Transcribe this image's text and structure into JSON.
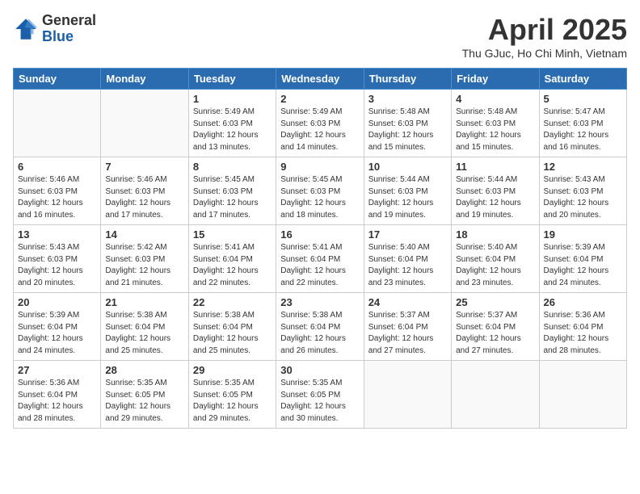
{
  "header": {
    "logo_general": "General",
    "logo_blue": "Blue",
    "month_year": "April 2025",
    "location": "Thu GJuc, Ho Chi Minh, Vietnam"
  },
  "weekdays": [
    "Sunday",
    "Monday",
    "Tuesday",
    "Wednesday",
    "Thursday",
    "Friday",
    "Saturday"
  ],
  "weeks": [
    [
      {
        "day": "",
        "info": ""
      },
      {
        "day": "",
        "info": ""
      },
      {
        "day": "1",
        "info": "Sunrise: 5:49 AM\nSunset: 6:03 PM\nDaylight: 12 hours\nand 13 minutes."
      },
      {
        "day": "2",
        "info": "Sunrise: 5:49 AM\nSunset: 6:03 PM\nDaylight: 12 hours\nand 14 minutes."
      },
      {
        "day": "3",
        "info": "Sunrise: 5:48 AM\nSunset: 6:03 PM\nDaylight: 12 hours\nand 15 minutes."
      },
      {
        "day": "4",
        "info": "Sunrise: 5:48 AM\nSunset: 6:03 PM\nDaylight: 12 hours\nand 15 minutes."
      },
      {
        "day": "5",
        "info": "Sunrise: 5:47 AM\nSunset: 6:03 PM\nDaylight: 12 hours\nand 16 minutes."
      }
    ],
    [
      {
        "day": "6",
        "info": "Sunrise: 5:46 AM\nSunset: 6:03 PM\nDaylight: 12 hours\nand 16 minutes."
      },
      {
        "day": "7",
        "info": "Sunrise: 5:46 AM\nSunset: 6:03 PM\nDaylight: 12 hours\nand 17 minutes."
      },
      {
        "day": "8",
        "info": "Sunrise: 5:45 AM\nSunset: 6:03 PM\nDaylight: 12 hours\nand 17 minutes."
      },
      {
        "day": "9",
        "info": "Sunrise: 5:45 AM\nSunset: 6:03 PM\nDaylight: 12 hours\nand 18 minutes."
      },
      {
        "day": "10",
        "info": "Sunrise: 5:44 AM\nSunset: 6:03 PM\nDaylight: 12 hours\nand 19 minutes."
      },
      {
        "day": "11",
        "info": "Sunrise: 5:44 AM\nSunset: 6:03 PM\nDaylight: 12 hours\nand 19 minutes."
      },
      {
        "day": "12",
        "info": "Sunrise: 5:43 AM\nSunset: 6:03 PM\nDaylight: 12 hours\nand 20 minutes."
      }
    ],
    [
      {
        "day": "13",
        "info": "Sunrise: 5:43 AM\nSunset: 6:03 PM\nDaylight: 12 hours\nand 20 minutes."
      },
      {
        "day": "14",
        "info": "Sunrise: 5:42 AM\nSunset: 6:03 PM\nDaylight: 12 hours\nand 21 minutes."
      },
      {
        "day": "15",
        "info": "Sunrise: 5:41 AM\nSunset: 6:04 PM\nDaylight: 12 hours\nand 22 minutes."
      },
      {
        "day": "16",
        "info": "Sunrise: 5:41 AM\nSunset: 6:04 PM\nDaylight: 12 hours\nand 22 minutes."
      },
      {
        "day": "17",
        "info": "Sunrise: 5:40 AM\nSunset: 6:04 PM\nDaylight: 12 hours\nand 23 minutes."
      },
      {
        "day": "18",
        "info": "Sunrise: 5:40 AM\nSunset: 6:04 PM\nDaylight: 12 hours\nand 23 minutes."
      },
      {
        "day": "19",
        "info": "Sunrise: 5:39 AM\nSunset: 6:04 PM\nDaylight: 12 hours\nand 24 minutes."
      }
    ],
    [
      {
        "day": "20",
        "info": "Sunrise: 5:39 AM\nSunset: 6:04 PM\nDaylight: 12 hours\nand 24 minutes."
      },
      {
        "day": "21",
        "info": "Sunrise: 5:38 AM\nSunset: 6:04 PM\nDaylight: 12 hours\nand 25 minutes."
      },
      {
        "day": "22",
        "info": "Sunrise: 5:38 AM\nSunset: 6:04 PM\nDaylight: 12 hours\nand 25 minutes."
      },
      {
        "day": "23",
        "info": "Sunrise: 5:38 AM\nSunset: 6:04 PM\nDaylight: 12 hours\nand 26 minutes."
      },
      {
        "day": "24",
        "info": "Sunrise: 5:37 AM\nSunset: 6:04 PM\nDaylight: 12 hours\nand 27 minutes."
      },
      {
        "day": "25",
        "info": "Sunrise: 5:37 AM\nSunset: 6:04 PM\nDaylight: 12 hours\nand 27 minutes."
      },
      {
        "day": "26",
        "info": "Sunrise: 5:36 AM\nSunset: 6:04 PM\nDaylight: 12 hours\nand 28 minutes."
      }
    ],
    [
      {
        "day": "27",
        "info": "Sunrise: 5:36 AM\nSunset: 6:04 PM\nDaylight: 12 hours\nand 28 minutes."
      },
      {
        "day": "28",
        "info": "Sunrise: 5:35 AM\nSunset: 6:05 PM\nDaylight: 12 hours\nand 29 minutes."
      },
      {
        "day": "29",
        "info": "Sunrise: 5:35 AM\nSunset: 6:05 PM\nDaylight: 12 hours\nand 29 minutes."
      },
      {
        "day": "30",
        "info": "Sunrise: 5:35 AM\nSunset: 6:05 PM\nDaylight: 12 hours\nand 30 minutes."
      },
      {
        "day": "",
        "info": ""
      },
      {
        "day": "",
        "info": ""
      },
      {
        "day": "",
        "info": ""
      }
    ]
  ]
}
